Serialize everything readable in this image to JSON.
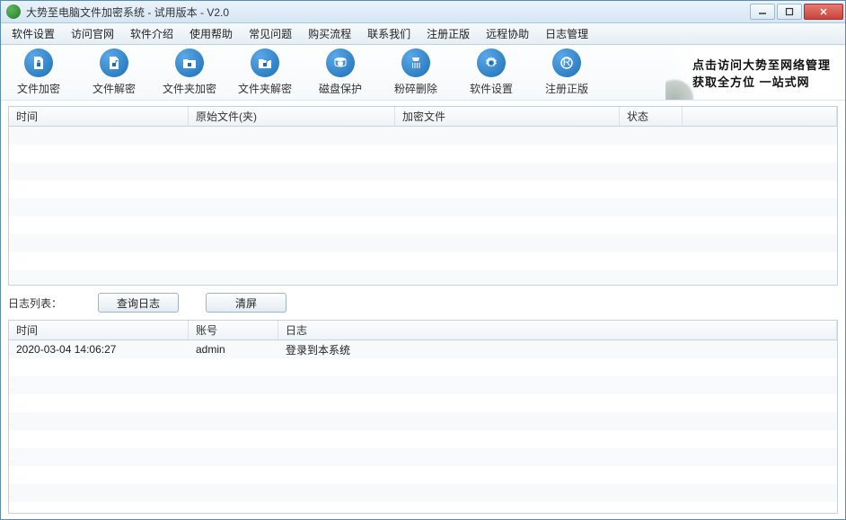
{
  "window": {
    "title": "大势至电脑文件加密系统 - 试用版本 - V2.0"
  },
  "menu": {
    "items": [
      {
        "label": "软件设置"
      },
      {
        "label": "访问官网"
      },
      {
        "label": "软件介绍"
      },
      {
        "label": "使用帮助"
      },
      {
        "label": "常见问题"
      },
      {
        "label": "购买流程"
      },
      {
        "label": "联系我们"
      },
      {
        "label": "注册正版"
      },
      {
        "label": "远程协助"
      },
      {
        "label": "日志管理"
      }
    ]
  },
  "toolbar": {
    "items": [
      {
        "name": "file-encrypt",
        "label": "文件加密",
        "icon": "file-lock"
      },
      {
        "name": "file-decrypt",
        "label": "文件解密",
        "icon": "file-unlock"
      },
      {
        "name": "folder-encrypt",
        "label": "文件夹加密",
        "icon": "folder-lock"
      },
      {
        "name": "folder-decrypt",
        "label": "文件夹解密",
        "icon": "folder-unlock"
      },
      {
        "name": "disk-protect",
        "label": "磁盘保护",
        "icon": "disk-shield"
      },
      {
        "name": "shred-delete",
        "label": "粉碎删除",
        "icon": "shred"
      },
      {
        "name": "settings",
        "label": "软件设置",
        "icon": "gear"
      },
      {
        "name": "register",
        "label": "注册正版",
        "icon": "register"
      }
    ]
  },
  "banner": {
    "line1": "点击访问大势至网络管理",
    "line2": "获取全方位 一站式网"
  },
  "grid1": {
    "headers": {
      "time": "时间",
      "source": "原始文件(夹)",
      "encrypted": "加密文件",
      "status": "状态"
    }
  },
  "logbar": {
    "label": "日志列表：",
    "query_btn": "查询日志",
    "clear_btn": "清屏"
  },
  "grid2": {
    "headers": {
      "time": "时间",
      "account": "账号",
      "log": "日志"
    },
    "rows": [
      {
        "time": "2020-03-04 14:06:27",
        "account": "admin",
        "log": "登录到本系统"
      }
    ]
  }
}
